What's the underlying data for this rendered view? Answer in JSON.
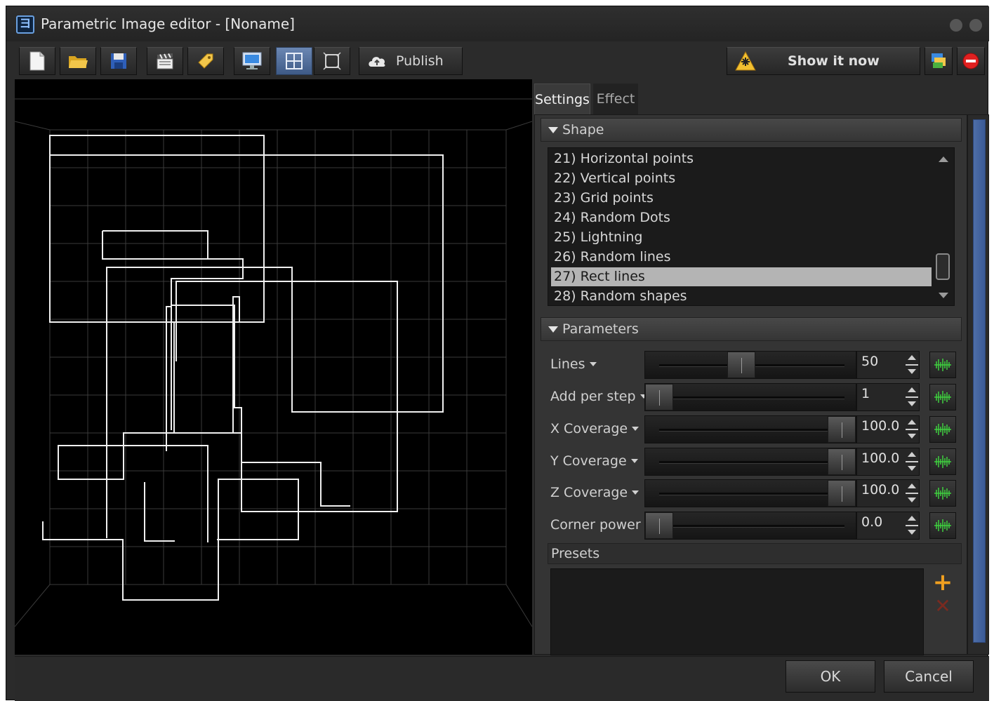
{
  "window": {
    "title": "Parametric Image editor - [Noname]",
    "app_icon_glyph": "ヨ"
  },
  "toolbar": {
    "buttons": [
      {
        "name": "new-file-icon"
      },
      {
        "name": "open-folder-icon"
      },
      {
        "name": "save-icon"
      },
      {
        "name": "clapperboard-icon"
      },
      {
        "name": "tag-icon"
      },
      {
        "name": "monitor-icon"
      },
      {
        "name": "grid-view-icon",
        "active": true
      },
      {
        "name": "frame-view-icon"
      }
    ],
    "publish_label": "Publish",
    "show_label": "Show it now"
  },
  "tabs": [
    {
      "label": "Settings",
      "active": true
    },
    {
      "label": "Effect",
      "active": false
    }
  ],
  "shape_section": {
    "title": "Shape",
    "items": [
      "21) Horizontal points",
      "22) Vertical points",
      "23) Grid points",
      "24) Random Dots",
      "25) Lightning",
      "26) Random lines",
      "27) Rect lines",
      "28) Random shapes"
    ],
    "selected": "27) Rect lines"
  },
  "parameters_section": {
    "title": "Parameters",
    "params": [
      {
        "label": "Lines",
        "value": "50",
        "level": 0.45
      },
      {
        "label": "Add per step",
        "value": "1",
        "level": 0.0
      },
      {
        "label": "X Coverage",
        "value": "100.0",
        "level": 1.0
      },
      {
        "label": "Y Coverage",
        "value": "100.0",
        "level": 1.0
      },
      {
        "label": "Z Coverage",
        "value": "100.0",
        "level": 1.0
      },
      {
        "label": "Corner power",
        "value": "0.0",
        "level": 0.0
      }
    ]
  },
  "presets": {
    "title": "Presets"
  },
  "dialog": {
    "ok_label": "OK",
    "cancel_label": "Cancel"
  },
  "colors": {
    "background": "#2b2b2b",
    "accent": "#4e6ea8",
    "selection": "#b4b4b4",
    "anim_green": "#3fd03f",
    "preset_add": "#f0a020"
  }
}
